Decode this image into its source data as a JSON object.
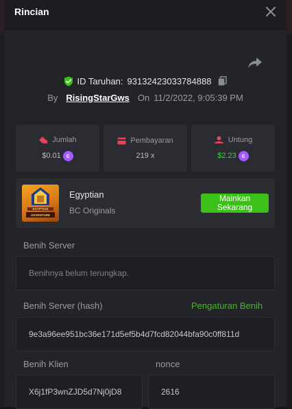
{
  "modal": {
    "title": "Rincian"
  },
  "bet": {
    "id_label": "ID Taruhan:",
    "id_value": "93132423033784888",
    "by_label": "By",
    "username": "RisingStarGws",
    "on_label": "On",
    "datetime": "11/2/2022, 9:05:39 PM"
  },
  "stats": [
    {
      "label": "Jumlah",
      "value": "$0.01",
      "icon": "bet-amount-icon",
      "coin": true,
      "color": "#b9bbc1"
    },
    {
      "label": "Pembayaran",
      "value": "219 x",
      "icon": "card-icon",
      "coin": false,
      "color": "#b9bbc1"
    },
    {
      "label": "Untung",
      "value": "$2.23",
      "icon": "profit-icon",
      "coin": true,
      "color": "#40d040"
    }
  ],
  "game": {
    "name": "Egyptian",
    "provider": "BC Originals",
    "play_label": "Mainkan\nSekarang",
    "logo_text": "EGYPTIAN ADVENTURE"
  },
  "seeds": {
    "server_label": "Benih Server",
    "server_value": "Benihnya belum terungkap.",
    "server_hash_label": "Benih Server (hash)",
    "settings_link": "Pengaturan Benih",
    "server_hash_value": "9e3a96ee951bc36e171d5ef5b4d7fcd82044bfa90c0ff811d",
    "client_label": "Benih Klien",
    "client_value": "X6j1fP3wnZJD5d7Nj0jD8",
    "nonce_label": "nonce",
    "nonce_value": "2616"
  },
  "colors": {
    "accent_green": "#3bc117",
    "coin_purple": "#a55cff",
    "shield_green": "#3bc117"
  }
}
